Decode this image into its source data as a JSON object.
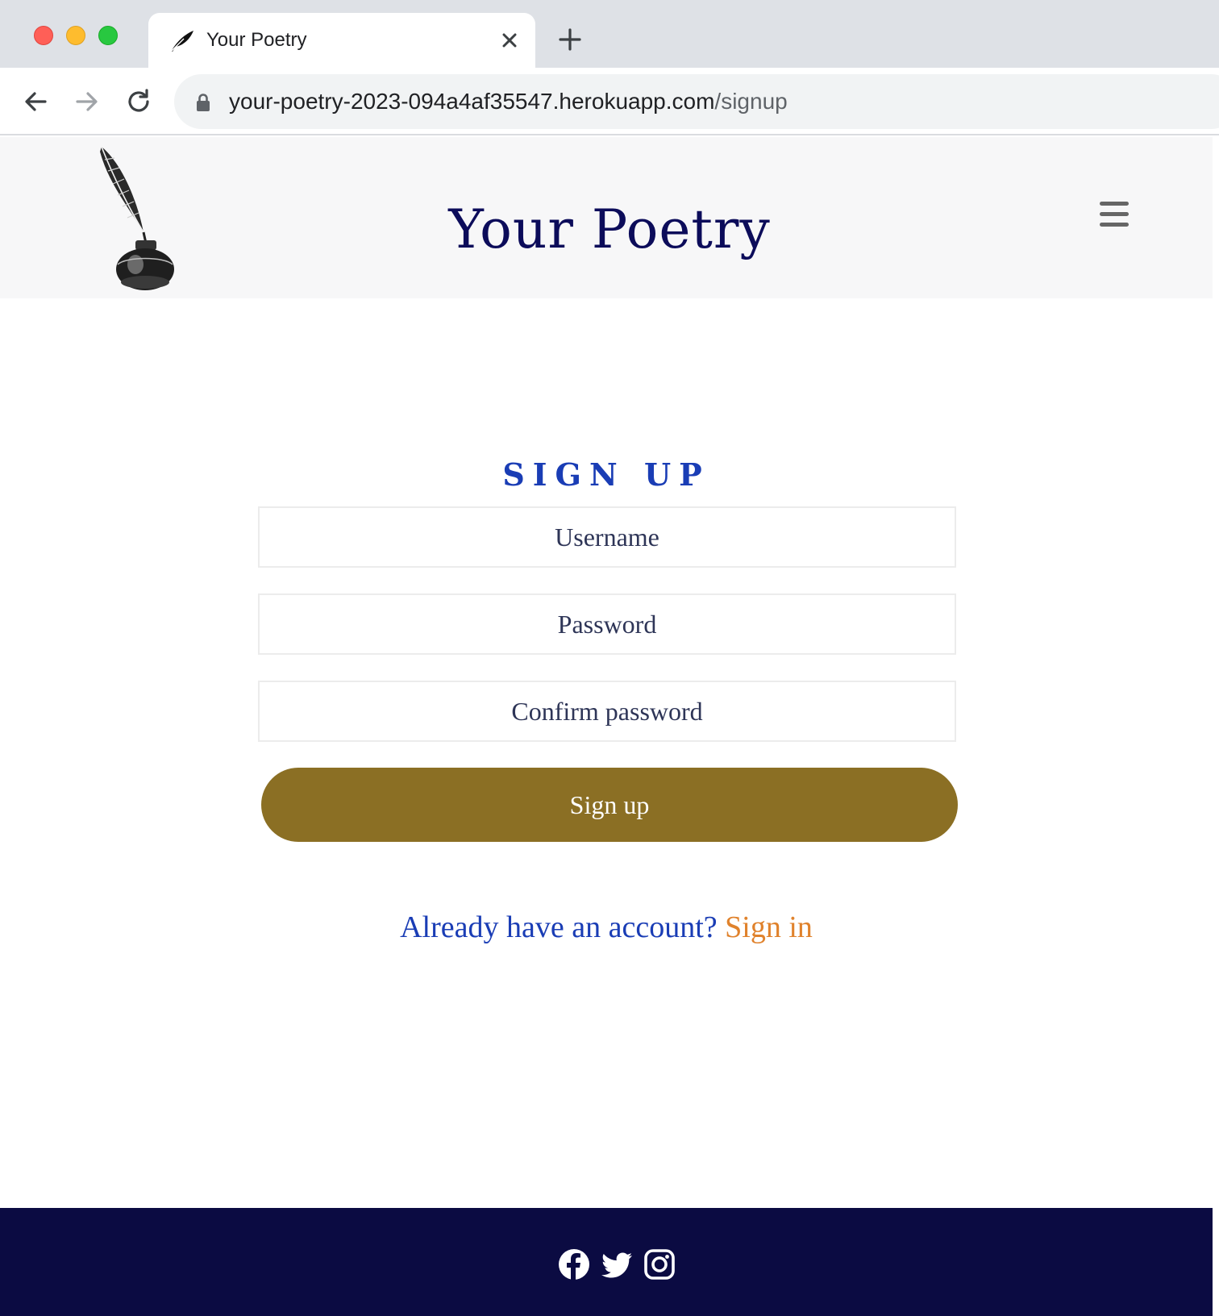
{
  "browser": {
    "tab_title": "Your Poetry",
    "url_host": "your-poetry-2023-094a4af35547.herokuapp.com",
    "url_path": "/signup"
  },
  "header": {
    "site_title": "Your Poetry",
    "logo_icon": "quill-inkwell-icon",
    "menu_icon": "hamburger-menu-icon"
  },
  "signup_form": {
    "heading": "SIGN UP",
    "username_placeholder": "Username",
    "password_placeholder": "Password",
    "confirm_placeholder": "Confirm password",
    "submit_label": "Sign up",
    "signin_prompt": "Already have an account?",
    "signin_link": "Sign in"
  },
  "footer": {
    "social_icons": [
      "facebook-icon",
      "twitter-icon",
      "instagram-icon"
    ]
  },
  "colors": {
    "title": "#0c0c5a",
    "heading": "#1a3db5",
    "button": "#8b6f24",
    "link": "#e0822c",
    "footer": "#0b0b42"
  }
}
